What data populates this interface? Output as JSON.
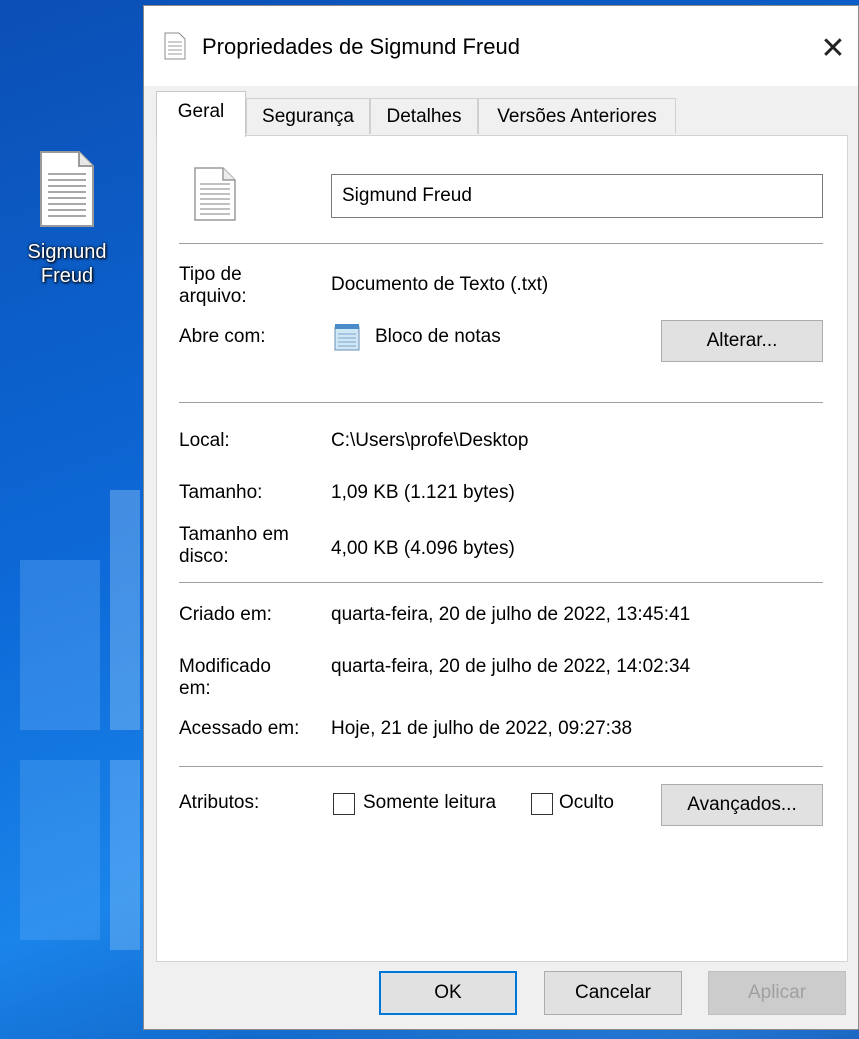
{
  "desktop": {
    "icon_label_line1": "Sigmund",
    "icon_label_line2": "Freud"
  },
  "window": {
    "title": "Propriedades de Sigmund Freud",
    "close_glyph": "✕"
  },
  "tabs": [
    {
      "label": "Geral",
      "active": true
    },
    {
      "label": "Segurança"
    },
    {
      "label": "Detalhes"
    },
    {
      "label": "Versões Anteriores"
    }
  ],
  "general": {
    "file_name": "Sigmund Freud",
    "type_label_line1": "Tipo de",
    "type_label_line2": "arquivo:",
    "type_value": "Documento de Texto (.txt)",
    "opens_with_label": "Abre com:",
    "opens_with_value": "Bloco de notas",
    "change_button": "Alterar...",
    "location_label": "Local:",
    "location_value": "C:\\Users\\profe\\Desktop",
    "size_label": "Tamanho:",
    "size_value": "1,09 KB (1.121 bytes)",
    "size_on_disk_label_line1": "Tamanho em",
    "size_on_disk_label_line2": "disco:",
    "size_on_disk_value": "4,00 KB (4.096 bytes)",
    "created_label": "Criado em:",
    "created_value": "quarta-feira, 20 de julho de 2022, 13:45:41",
    "modified_label_line1": "Modificado",
    "modified_label_line2": "em:",
    "modified_value": "quarta-feira, 20 de julho de 2022, 14:02:34",
    "accessed_label": "Acessado em:",
    "accessed_value": "Hoje, 21 de julho de 2022, 09:27:38",
    "attributes_label": "Atributos:",
    "readonly_label": "Somente leitura",
    "hidden_label": "Oculto",
    "advanced_button": "Avançados..."
  },
  "footer": {
    "ok": "OK",
    "cancel": "Cancelar",
    "apply": "Aplicar"
  }
}
